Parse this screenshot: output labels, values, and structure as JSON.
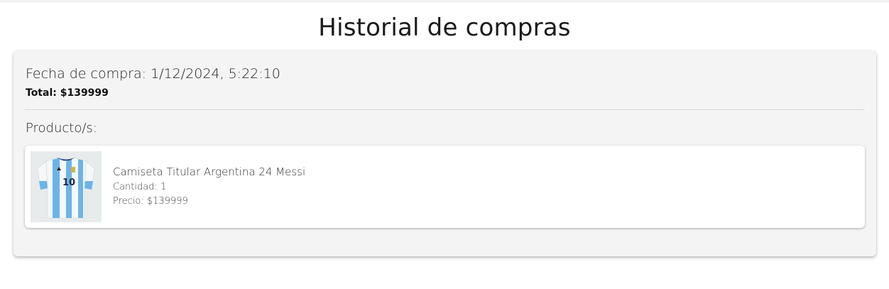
{
  "page": {
    "title": "Historial de compras"
  },
  "orders": [
    {
      "date_label": "Fecha de compra: 1/12/2024, 5:22:10",
      "total_label": "Total: $139999",
      "products_label": "Producto/s:",
      "products": [
        {
          "image_icon": "jersey-image",
          "name": "Camiseta Titular Argentina 24 Messi",
          "quantity_label": "Cantidad: 1",
          "price_label": "Precio: $139999"
        }
      ]
    }
  ],
  "colors": {
    "page_bg": "#ffffff",
    "card_bg": "#f4f4f4",
    "product_bg": "#ffffff",
    "jersey_blue": "#6cb4e8",
    "jersey_white": "#f5f7f8"
  }
}
